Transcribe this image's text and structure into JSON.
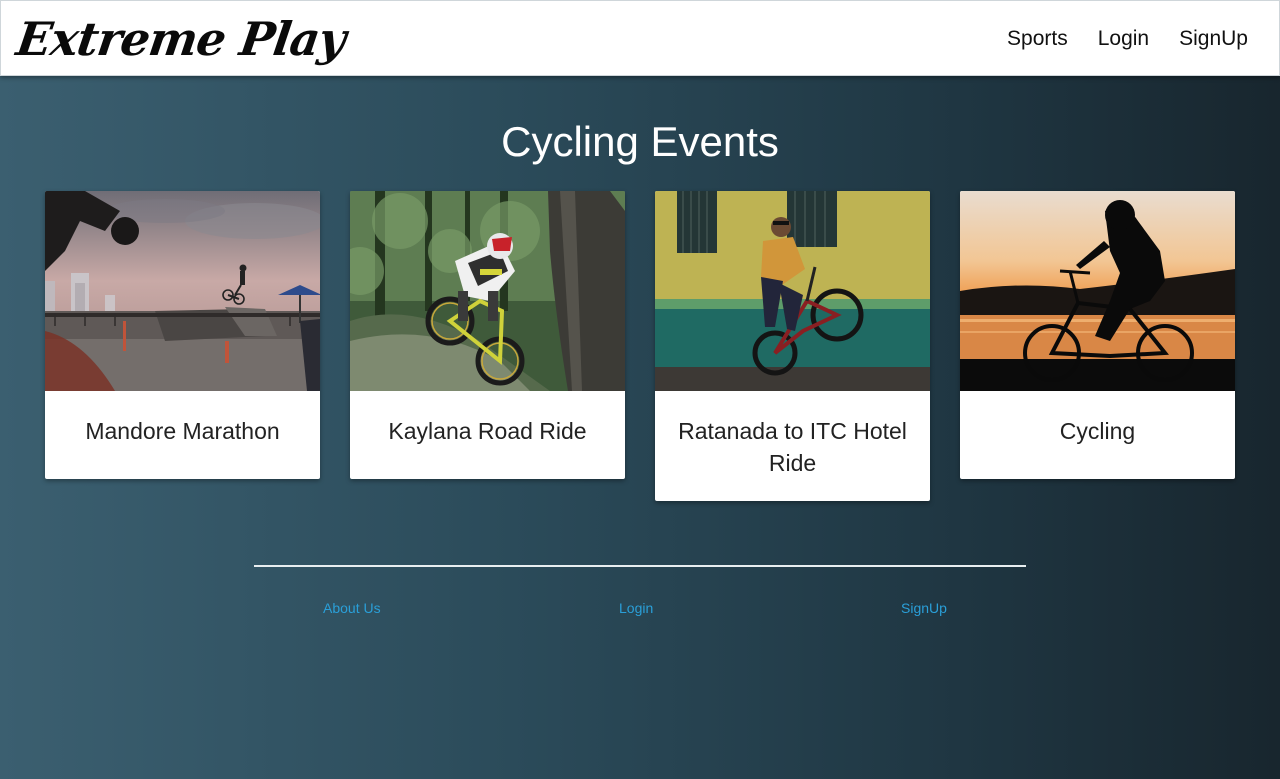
{
  "navbar": {
    "brand": "Extreme Play",
    "links": [
      "Sports",
      "Login",
      "SignUp"
    ]
  },
  "page": {
    "title": "Cycling Events"
  },
  "events": [
    {
      "title": "Mandore Marathon",
      "image": "bmx-skatepark-photo"
    },
    {
      "title": "Kaylana Road Ride",
      "image": "downhill-forest-photo"
    },
    {
      "title": "Ratanada to ITC Hotel Ride",
      "image": "wheelie-street-photo"
    },
    {
      "title": "Cycling",
      "image": "sunset-silhouette-photo"
    }
  ],
  "footer": {
    "links": [
      "About Us",
      "Login",
      "SignUp"
    ]
  },
  "colors": {
    "background_start": "#3b5f70",
    "background_end": "#18262e",
    "footer_link": "#2a9fd8",
    "card_bg": "#ffffff"
  }
}
